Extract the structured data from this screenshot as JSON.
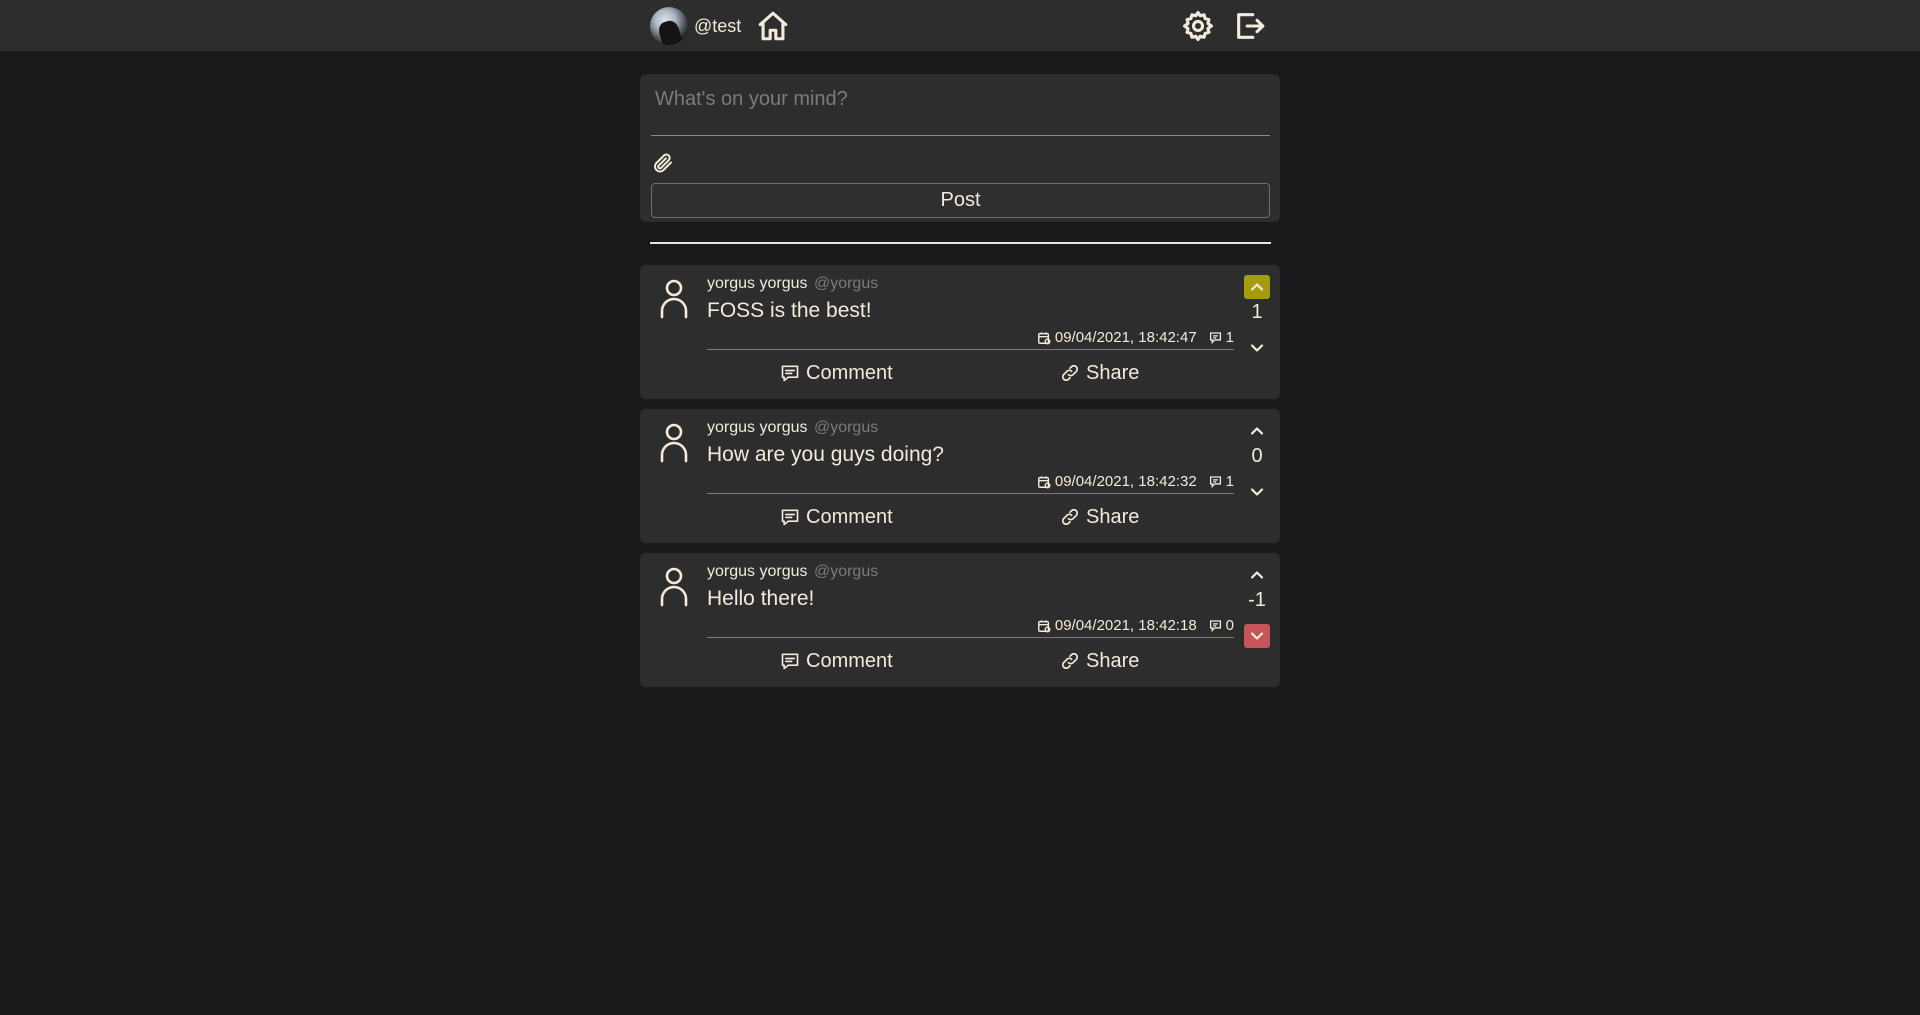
{
  "header": {
    "handle": "@test"
  },
  "composer": {
    "placeholder": "What's on your mind?",
    "post_label": "Post"
  },
  "posts": [
    {
      "name": "yorgus yorgus",
      "username": "@yorgus",
      "text": "FOSS is the best!",
      "date": "09/04/2021, 18:42:47",
      "comment_count": "1",
      "score": "1",
      "vote": "up",
      "comment_label": "Comment",
      "share_label": "Share"
    },
    {
      "name": "yorgus yorgus",
      "username": "@yorgus",
      "text": "How are you guys doing?",
      "date": "09/04/2021, 18:42:32",
      "comment_count": "1",
      "score": "0",
      "vote": "none",
      "comment_label": "Comment",
      "share_label": "Share"
    },
    {
      "name": "yorgus yorgus",
      "username": "@yorgus",
      "text": "Hello there!",
      "date": "09/04/2021, 18:42:18",
      "comment_count": "0",
      "score": "-1",
      "vote": "down",
      "comment_label": "Comment",
      "share_label": "Share"
    }
  ],
  "colors": {
    "background": "#18191b",
    "panel": "#2d2d2e",
    "text": "#f3ead9",
    "muted": "#7d7b78",
    "upvote_active": "#a59d0e",
    "downvote_active": "#c9535a"
  }
}
